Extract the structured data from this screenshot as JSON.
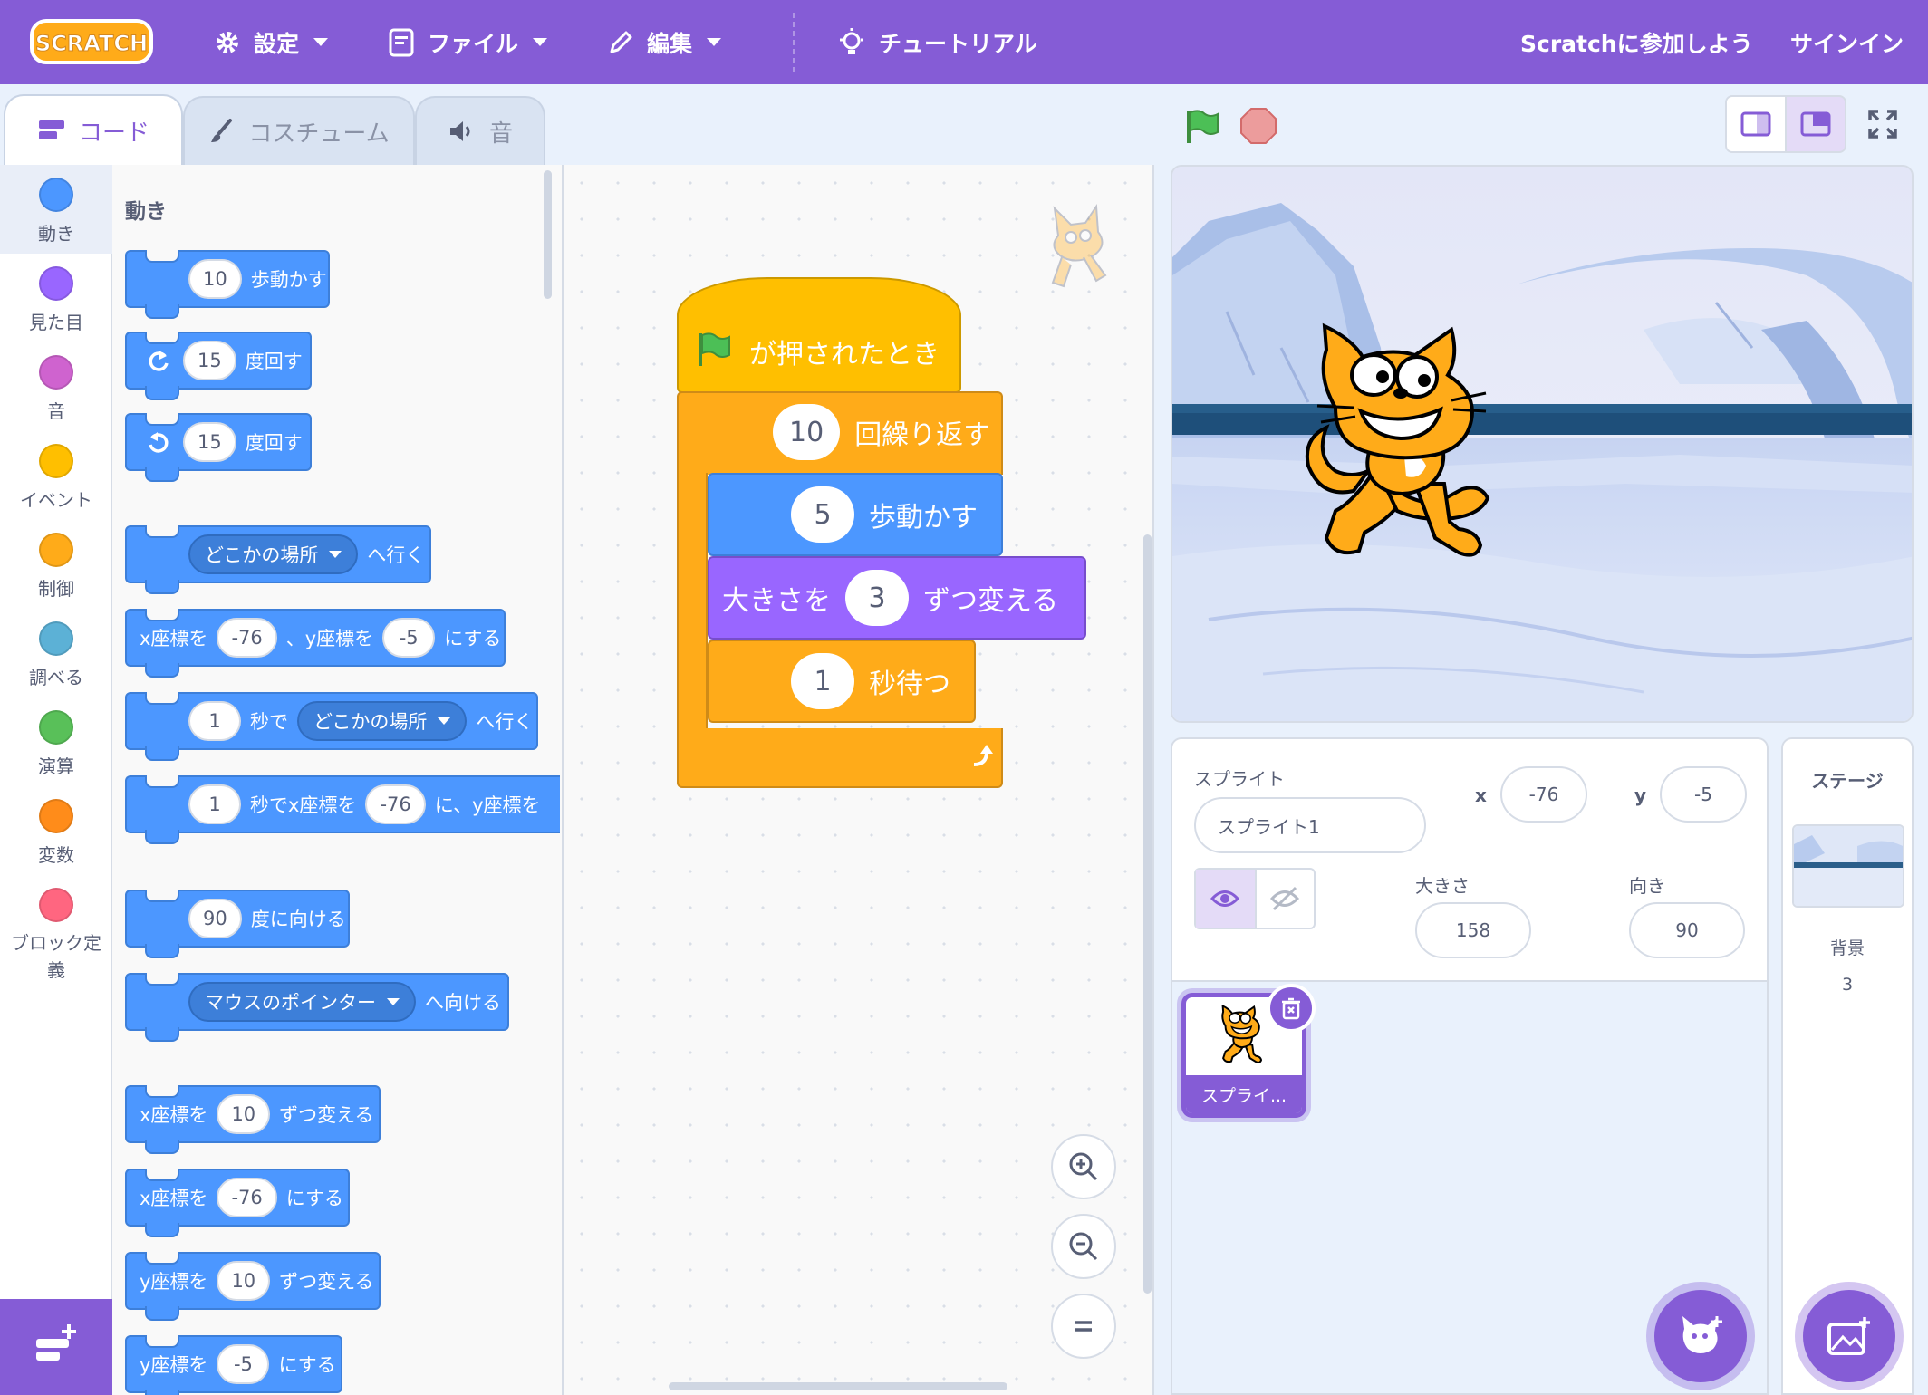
{
  "menu": {
    "logo_text": "SCRATCH",
    "settings": "設定",
    "file": "ファイル",
    "edit": "編集",
    "tutorials": "チュートリアル",
    "join": "Scratchに参加しよう",
    "signin": "サインイン"
  },
  "tabs": {
    "code": "コード",
    "costumes": "コスチューム",
    "sounds": "音"
  },
  "categories": [
    {
      "label": "動き",
      "color": "#4c97ff"
    },
    {
      "label": "見た目",
      "color": "#9966ff"
    },
    {
      "label": "音",
      "color": "#cf63cf"
    },
    {
      "label": "イベント",
      "color": "#ffbf00"
    },
    {
      "label": "制御",
      "color": "#ffab19"
    },
    {
      "label": "調べる",
      "color": "#5cb1d6"
    },
    {
      "label": "演算",
      "color": "#59c059"
    },
    {
      "label": "変数",
      "color": "#ff8c1a"
    },
    {
      "label": "ブロック定義",
      "color": "#ff6680"
    }
  ],
  "palette": {
    "heading": "動き",
    "move": {
      "value": "10",
      "text": "歩動かす"
    },
    "turn_right": {
      "value": "15",
      "text": "度回す"
    },
    "turn_left": {
      "value": "15",
      "text": "度回す"
    },
    "goto": {
      "dropdown": "どこかの場所",
      "text": "へ行く"
    },
    "gotoxy": {
      "pre": "x座標を",
      "x": "-76",
      "mid": "、y座標を",
      "y": "-5",
      "post": "にする"
    },
    "glide": {
      "value": "1",
      "mid": "秒で",
      "dropdown": "どこかの場所",
      "post": "へ行く"
    },
    "glidexy": {
      "value": "1",
      "mid": "秒でx座標を",
      "x": "-76",
      "post": "に、y座標を"
    },
    "point": {
      "value": "90",
      "text": "度に向ける"
    },
    "pointto": {
      "dropdown": "マウスのポインター",
      "text": "へ向ける"
    },
    "changex": {
      "pre": "x座標を",
      "value": "10",
      "post": "ずつ変える"
    },
    "setx": {
      "pre": "x座標を",
      "value": "-76",
      "post": "にする"
    },
    "changey": {
      "pre": "y座標を",
      "value": "10",
      "post": "ずつ変える"
    },
    "sety": {
      "pre": "y座標を",
      "value": "-5",
      "post": "にする"
    }
  },
  "script": {
    "hat": "が押されたとき",
    "repeat": {
      "value": "10",
      "text": "回繰り返す"
    },
    "move": {
      "value": "5",
      "text": "歩動かす"
    },
    "size": {
      "pre": "大きさを",
      "value": "3",
      "post": "ずつ変える"
    },
    "wait": {
      "value": "1",
      "text": "秒待つ"
    }
  },
  "sprite": {
    "label": "スプライト",
    "name": "スプライト1",
    "x_label": "x",
    "x": "-76",
    "y_label": "y",
    "y": "-5",
    "size_label": "大きさ",
    "size": "158",
    "direction_label": "向き",
    "direction": "90",
    "thumb_label": "スプライ..."
  },
  "stage_panel": {
    "title": "ステージ",
    "backdrop_label": "背景",
    "backdrop_count": "3"
  },
  "colors": {
    "accent": "#855cd6",
    "motion": "#4c97ff",
    "looks": "#9966ff",
    "events": "#ffbf00",
    "control": "#ffab19"
  }
}
